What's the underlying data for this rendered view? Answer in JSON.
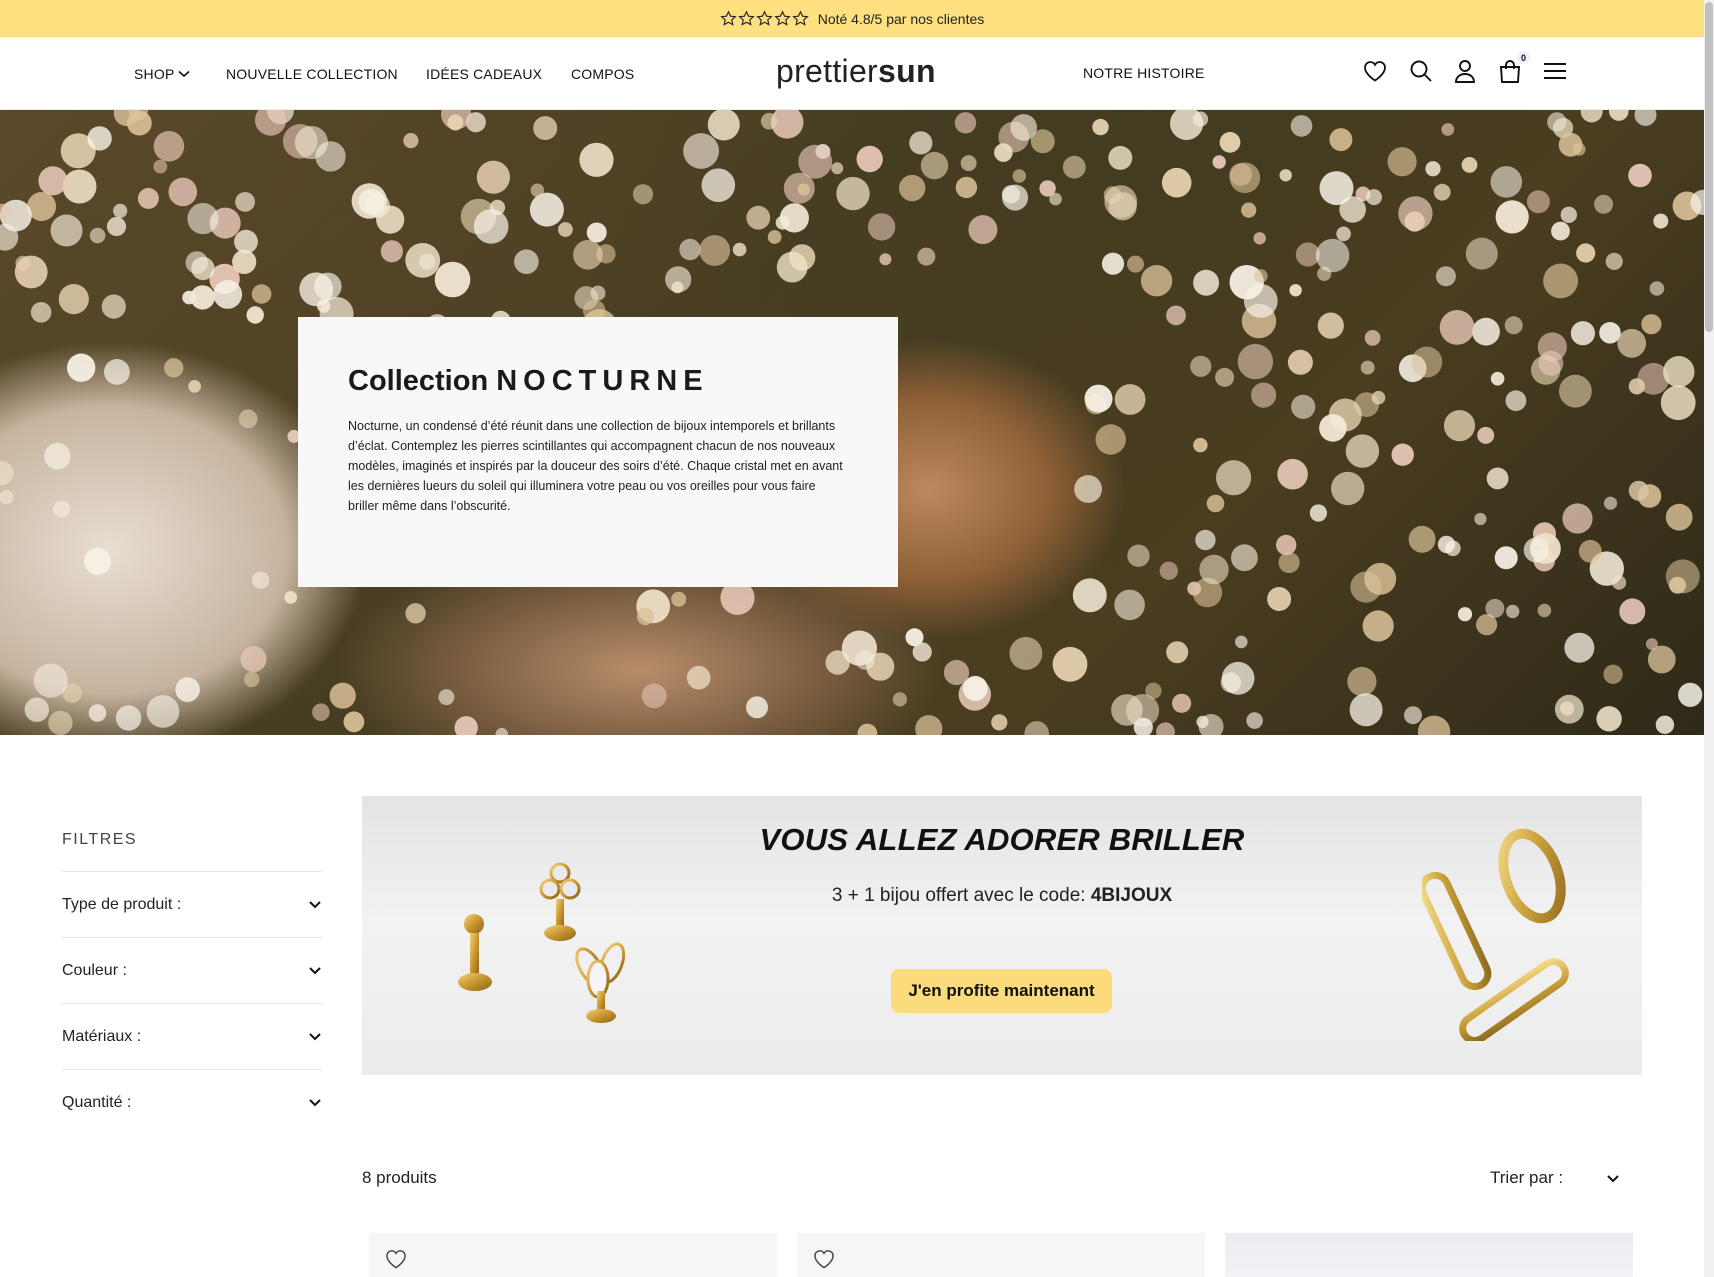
{
  "announcement": {
    "rating_text": "Noté 4.8/5 par nos clientes",
    "star_count": 5
  },
  "nav": {
    "shop": "SHOP",
    "new_collection": "NOUVELLE COLLECTION",
    "gift_ideas": "IDÉES CADEAUX",
    "compos": "COMPOS",
    "story": "NOTRE HISTOIRE"
  },
  "logo": {
    "light": "prettier",
    "bold": "sun"
  },
  "cart": {
    "count": "0"
  },
  "hero": {
    "title_prefix": "Collection",
    "title_word": "NOCTURNE",
    "text": "Nocturne, un condensé d’été réunit dans une collection de bijoux intemporels et brillants d’éclat. Contemplez les pierres scintillantes qui accompagnent chacun de nos nouveaux modèles, imaginés et inspirés par la douceur des soirs d’été. Chaque cristal met en avant les dernières lueurs du soleil qui illuminera votre peau ou vos oreilles pour vous faire briller même dans l’obscurité."
  },
  "filters": {
    "title": "FILTRES",
    "items": [
      "Type de produit :",
      "Couleur :",
      "Matériaux :",
      "Quantité :"
    ]
  },
  "promo": {
    "title": "VOUS ALLEZ ADORER BRILLER",
    "subtitle_prefix": "3 + 1 bijou offert avec le code:",
    "code": "4BIJOUX",
    "button": "J'en profite maintenant"
  },
  "products": {
    "count_label": "8 produits",
    "sort_label": "Trier par :"
  },
  "colors": {
    "announcement_bg": "#fde07f",
    "button_bg": "#fbdb7b",
    "hero_card_bg": "#f8f8f8"
  }
}
